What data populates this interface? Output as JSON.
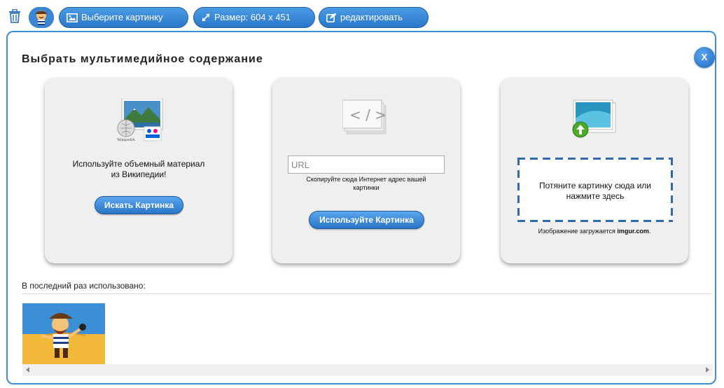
{
  "toolbar": {
    "choose_image_label": "Выберите картинку",
    "size_label": "Размер: 604 x 451",
    "edit_label": "редактировать"
  },
  "modal": {
    "title": "Выбрать мультимедийное содержание",
    "close_label": "X"
  },
  "wiki_card": {
    "text_line1": "Используйте объемный материал",
    "text_line2": "из Википедии!",
    "button_label": "Искать Картинка"
  },
  "url_card": {
    "placeholder": "URL",
    "hint_line1": "Скопируйте сюда Интернет адрес вашей",
    "hint_line2": "картинки",
    "button_label": "Используйте Картинка"
  },
  "upload_card": {
    "drop_line1": "Потяните картинку сюда или",
    "drop_line2": "нажмите здесь",
    "note_prefix": "Изображение загружается ",
    "note_host": "imgur.com",
    "note_suffix": "."
  },
  "recent": {
    "label": "В последний раз использовано:"
  },
  "colors": {
    "accent": "#2b78c8",
    "border": "#3d8ad8",
    "card_bg": "#efefef",
    "dash": "#2d6ab0"
  }
}
